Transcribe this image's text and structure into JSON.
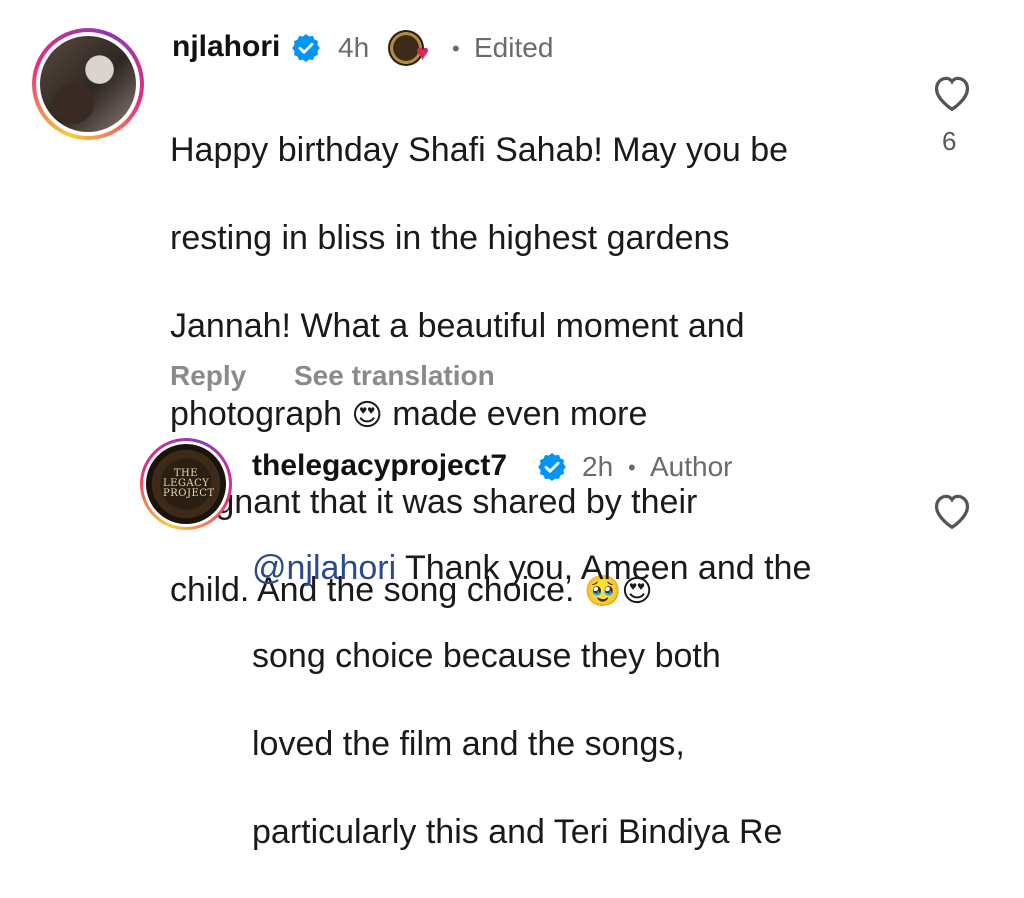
{
  "comment": {
    "username": "njlahori",
    "time": "4h",
    "edited": "Edited",
    "text_lines": [
      "Happy birthday Shafi Sahab!  May you be",
      "resting in bliss in the highest gardens",
      "Jannah! What a beautiful moment and",
      "photograph",
      "made even more",
      "poignant that it was shared by their",
      "child. And the song choice."
    ],
    "emoji_heart_eyes": "😍",
    "emoji_teary": "🥹",
    "reply_label": "Reply",
    "translate_label": "See translation",
    "like_count": "6"
  },
  "reply": {
    "username": "thelegacyproject7",
    "time": "2h",
    "role": "Author",
    "mention": "@njlahori",
    "text_first": " Thank you, Ameen and the",
    "text_lines": [
      "song choice because they both",
      "loved the film and the songs,",
      "particularly this and Teri Bindiya Re"
    ],
    "avatar_logo": "THE LEGACY PROJECT"
  },
  "colors": {
    "verified": "#0095f6",
    "muted": "#6b6b6b",
    "mention": "#2a4b8d"
  },
  "icons": [
    "verified-badge-icon",
    "heart-outline-icon",
    "heart-emoji-icon"
  ]
}
